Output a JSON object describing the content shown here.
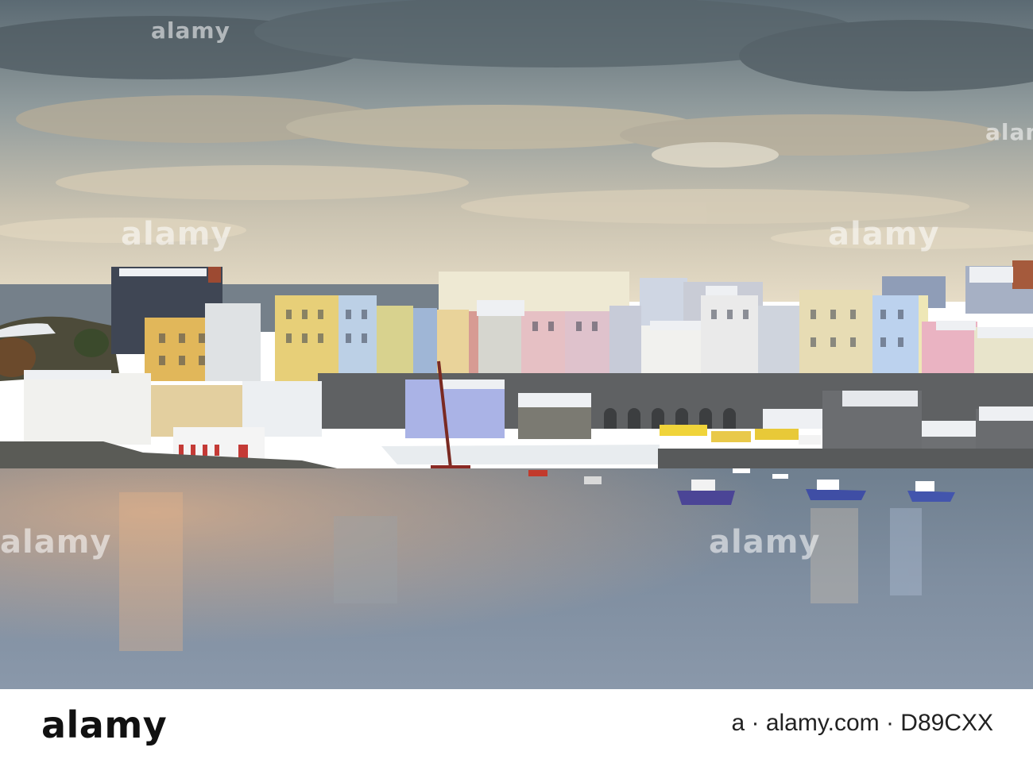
{
  "photo": {
    "watermark": "alamy"
  },
  "footer": {
    "logo": "alamy",
    "stock_id_text": "a · alamy.com · D89CXX"
  }
}
